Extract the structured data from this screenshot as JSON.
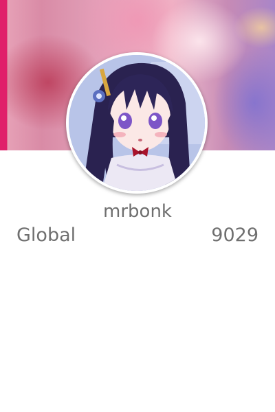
{
  "profile": {
    "username": "mrbonk",
    "rank_label": "Global",
    "rank_value": "9029"
  },
  "banner": {
    "description_icon": "anime-character-banner"
  },
  "avatar": {
    "icon": "anime-girl-avatar"
  },
  "colors": {
    "text": "#6f6f6f",
    "background": "#ffffff",
    "banner_accent": "#e01f6a"
  }
}
